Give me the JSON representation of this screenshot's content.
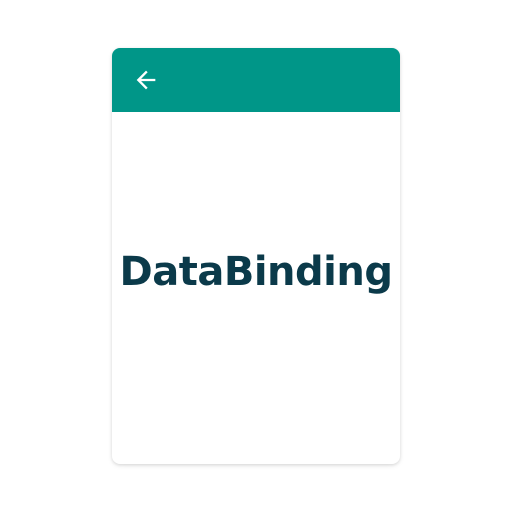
{
  "app_bar": {
    "back_icon": "arrow-left-icon",
    "background_color": "#009688",
    "icon_color": "#ffffff"
  },
  "content": {
    "title": "DataBinding",
    "text_color": "#0b3a4a"
  }
}
